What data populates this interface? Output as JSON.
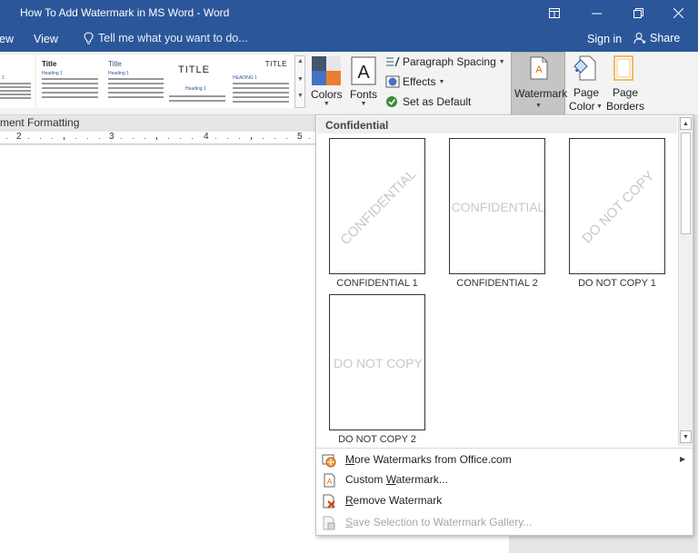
{
  "window": {
    "title": "How To Add Watermark in MS Word - Word"
  },
  "tabs": {
    "view_partial": "ew",
    "view": "View",
    "tell_me": "Tell me what you want to do...",
    "sign_in": "Sign in",
    "share": "Share"
  },
  "ribbon": {
    "style_gallery": [
      {
        "title": "",
        "heading": "1"
      },
      {
        "title": "Title",
        "heading": "Heading 1"
      },
      {
        "title": "Title",
        "heading": "Heading 1"
      },
      {
        "title": "TITLE",
        "heading": "Heading 1"
      },
      {
        "title": "TITLE",
        "heading": "HEADING 1"
      }
    ],
    "colors_label": "Colors",
    "fonts_label": "Fonts",
    "paragraph_spacing_label": "Paragraph Spacing",
    "effects_label": "Effects",
    "set_default_label": "Set as Default",
    "watermark_label": "Watermark",
    "page_color_label_1": "Page",
    "page_color_label_2": "Color",
    "page_borders_label_1": "Page",
    "page_borders_label_2": "Borders",
    "group_label_partial": "ment Formatting"
  },
  "ruler": {
    "numbers": [
      "2",
      "3",
      "4",
      "5"
    ]
  },
  "watermark_menu": {
    "section_title": "Confidential",
    "items": [
      {
        "watermark_text": "CONFIDENTIAL",
        "caption": "CONFIDENTIAL 1",
        "orientation": "diagonal"
      },
      {
        "watermark_text": "CONFIDENTIAL",
        "caption": "CONFIDENTIAL 2",
        "orientation": "horizontal"
      },
      {
        "watermark_text": "DO NOT COPY",
        "caption": "DO NOT COPY 1",
        "orientation": "diagonal"
      },
      {
        "watermark_text": "DO NOT COPY",
        "caption": "DO NOT COPY 2",
        "orientation": "horizontal"
      }
    ],
    "menu_items": [
      {
        "pre": "",
        "key": "M",
        "post": "ore Watermarks from Office.com",
        "has_submenu": true,
        "disabled": false,
        "icon": "office-globe-icon"
      },
      {
        "pre": "Custom ",
        "key": "W",
        "post": "atermark...",
        "has_submenu": false,
        "disabled": false,
        "icon": "custom-watermark-icon"
      },
      {
        "pre": "",
        "key": "R",
        "post": "emove Watermark",
        "has_submenu": false,
        "disabled": false,
        "icon": "remove-watermark-icon"
      },
      {
        "pre": "",
        "key": "S",
        "post": "ave Selection to Watermark Gallery...",
        "has_submenu": false,
        "disabled": true,
        "icon": "save-selection-icon"
      }
    ]
  },
  "colors": {
    "title_bar": "#2b579a",
    "accent_orange": "#e46c0a",
    "accent_blue": "#2f5496",
    "watermark_gray": "#c8c8c8"
  }
}
